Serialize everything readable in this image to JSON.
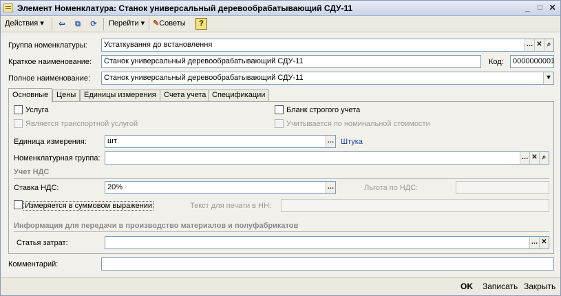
{
  "window": {
    "title": "Элемент Номенклатура: Станок универсальный деревообрабатывающий СДУ-11"
  },
  "toolbar": {
    "actions_label": "Действия",
    "goto_label": "Перейти",
    "tips_label": "Советы",
    "help_label": "?"
  },
  "form": {
    "group_label": "Группа номенклатуры:",
    "group_value": "Устаткування до встановлення",
    "short_name_label": "Краткое наименование:",
    "short_name_value": "Станок универсальный деревообрабатывающий СДУ-11",
    "code_label": "Код:",
    "code_value": "0000000001",
    "full_name_label": "Полное наименование:",
    "full_name_value": "Станок универсальный деревообрабатывающий СДУ-11"
  },
  "tabs": [
    {
      "label": "Основные"
    },
    {
      "label": "Цены"
    },
    {
      "label": "Единицы измерения"
    },
    {
      "label": "Счета учета"
    },
    {
      "label": "Спецификации"
    }
  ],
  "main": {
    "service_label": "Услуга",
    "transport_label": "Является транспортной услугой",
    "strict_blank_label": "Бланк строгого учета",
    "nominal_cost_label": "Учитывается по номинальной стоимости",
    "unit_label": "Единица измерения:",
    "unit_value": "шт",
    "unit_link": "Штука",
    "nom_group_label": "Номенклатурная группа:",
    "nom_group_value": "",
    "vat_section": "Учет НДС",
    "vat_rate_label": "Ставка НДС:",
    "vat_rate_value": "20%",
    "vat_benefit_label": "Льгота по НДС:",
    "sum_measure_label": "Измеряется в суммовом выражении",
    "print_text_label": "Текст для печати в НН:",
    "production_section": "Информация для передачи в производство материалов и полуфабрикатов",
    "cost_item_label": "Статья затрат:",
    "cost_item_value": ""
  },
  "comment": {
    "label": "Комментарий:",
    "value": ""
  },
  "footer": {
    "ok_label": "OK",
    "save_label": "Записать",
    "close_label": "Закрыть"
  }
}
